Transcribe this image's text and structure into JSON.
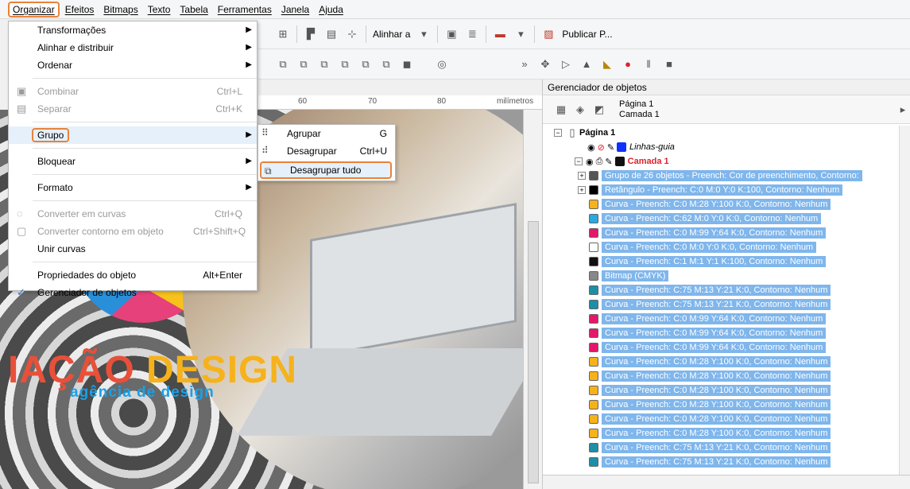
{
  "menubar": {
    "items": [
      "Organizar",
      "Efeitos",
      "Bitmaps",
      "Texto",
      "Tabela",
      "Ferramentas",
      "Janela",
      "Ajuda"
    ]
  },
  "toolbar": {
    "align_label": "Alinhar a",
    "publish_label": "Publicar P..."
  },
  "ruler": {
    "marks": [
      "60",
      "70",
      "80",
      "milímetros"
    ]
  },
  "canvas": {
    "logo_main_a": "IAÇÃO",
    "logo_main_b": "DESIGN",
    "logo_sub": "agência de design"
  },
  "menu": {
    "items": [
      {
        "label": "Transformações",
        "shortcut": "",
        "arrow": true,
        "disabled": false
      },
      {
        "label": "Alinhar e distribuir",
        "shortcut": "",
        "arrow": true,
        "disabled": false
      },
      {
        "label": "Ordenar",
        "shortcut": "",
        "arrow": true,
        "disabled": false
      },
      {
        "label": "Combinar",
        "shortcut": "Ctrl+L",
        "arrow": false,
        "disabled": true
      },
      {
        "label": "Separar",
        "shortcut": "Ctrl+K",
        "arrow": false,
        "disabled": true
      },
      {
        "label": "Grupo",
        "shortcut": "",
        "arrow": true,
        "disabled": false
      },
      {
        "label": "Bloquear",
        "shortcut": "",
        "arrow": true,
        "disabled": false
      },
      {
        "label": "Formato",
        "shortcut": "",
        "arrow": true,
        "disabled": false
      },
      {
        "label": "Converter em curvas",
        "shortcut": "Ctrl+Q",
        "arrow": false,
        "disabled": true
      },
      {
        "label": "Converter contorno em objeto",
        "shortcut": "Ctrl+Shift+Q",
        "arrow": false,
        "disabled": true
      },
      {
        "label": "Unir curvas",
        "shortcut": "",
        "arrow": false,
        "disabled": false
      },
      {
        "label": "Propriedades do objeto",
        "shortcut": "Alt+Enter",
        "arrow": false,
        "disabled": false
      },
      {
        "label": "Gerenciador de objetos",
        "shortcut": "",
        "arrow": false,
        "disabled": false,
        "checked": true
      }
    ]
  },
  "submenu": {
    "items": [
      {
        "label": "Agrupar",
        "shortcut": "G"
      },
      {
        "label": "Desagrupar",
        "shortcut": "Ctrl+U"
      },
      {
        "label": "Desagrupar tudo",
        "shortcut": ""
      }
    ]
  },
  "panel": {
    "title": "Gerenciador de objetos",
    "page_label": "Página 1",
    "layer_label": "Camada 1",
    "tree_page": "Página 1",
    "tree_guides": "Linhas-guia",
    "tree_layer": "Camada 1",
    "rows": [
      {
        "text": "Grupo de 26 objetos - Preench: Cor de preenchimento, Contorno:",
        "color": "#555555",
        "expand": true
      },
      {
        "text": "Retângulo - Preench: C:0 M:0 Y:0 K:100, Contorno: Nenhum",
        "color": "#000000",
        "expand": true
      },
      {
        "text": "Curva - Preench: C:0 M:28 Y:100 K:0, Contorno: Nenhum",
        "color": "#f6b21b"
      },
      {
        "text": "Curva - Preench: C:62 M:0 Y:0 K:0, Contorno: Nenhum",
        "color": "#2aa8e0"
      },
      {
        "text": "Curva - Preench: C:0 M:99 Y:64 K:0, Contorno: Nenhum",
        "color": "#e6176a"
      },
      {
        "text": "Curva - Preench: C:0 M:0 Y:0 K:0, Contorno: Nenhum",
        "color": "#ffffff"
      },
      {
        "text": "Curva - Preench: C:1 M:1 Y:1 K:100, Contorno: Nenhum",
        "color": "#111111"
      },
      {
        "text": "Bitmap (CMYK)",
        "color": "#888888"
      },
      {
        "text": "Curva - Preench: C:75 M:13 Y:21 K:0, Contorno: Nenhum",
        "color": "#1c8fa6"
      },
      {
        "text": "Curva - Preench: C:75 M:13 Y:21 K:0, Contorno: Nenhum",
        "color": "#1c8fa6"
      },
      {
        "text": "Curva - Preench: C:0 M:99 Y:64 K:0, Contorno: Nenhum",
        "color": "#e6176a"
      },
      {
        "text": "Curva - Preench: C:0 M:99 Y:64 K:0, Contorno: Nenhum",
        "color": "#e6176a"
      },
      {
        "text": "Curva - Preench: C:0 M:99 Y:64 K:0, Contorno: Nenhum",
        "color": "#e6176a"
      },
      {
        "text": "Curva - Preench: C:0 M:28 Y:100 K:0, Contorno: Nenhum",
        "color": "#f6b21b"
      },
      {
        "text": "Curva - Preench: C:0 M:28 Y:100 K:0, Contorno: Nenhum",
        "color": "#f6b21b"
      },
      {
        "text": "Curva - Preench: C:0 M:28 Y:100 K:0, Contorno: Nenhum",
        "color": "#f6b21b"
      },
      {
        "text": "Curva - Preench: C:0 M:28 Y:100 K:0, Contorno: Nenhum",
        "color": "#f6b21b"
      },
      {
        "text": "Curva - Preench: C:0 M:28 Y:100 K:0, Contorno: Nenhum",
        "color": "#f6b21b"
      },
      {
        "text": "Curva - Preench: C:0 M:28 Y:100 K:0, Contorno: Nenhum",
        "color": "#f6b21b"
      },
      {
        "text": "Curva - Preench: C:75 M:13 Y:21 K:0, Contorno: Nenhum",
        "color": "#1c8fa6"
      },
      {
        "text": "Curva - Preench: C:75 M:13 Y:21 K:0, Contorno: Nenhum",
        "color": "#1c8fa6"
      }
    ]
  }
}
